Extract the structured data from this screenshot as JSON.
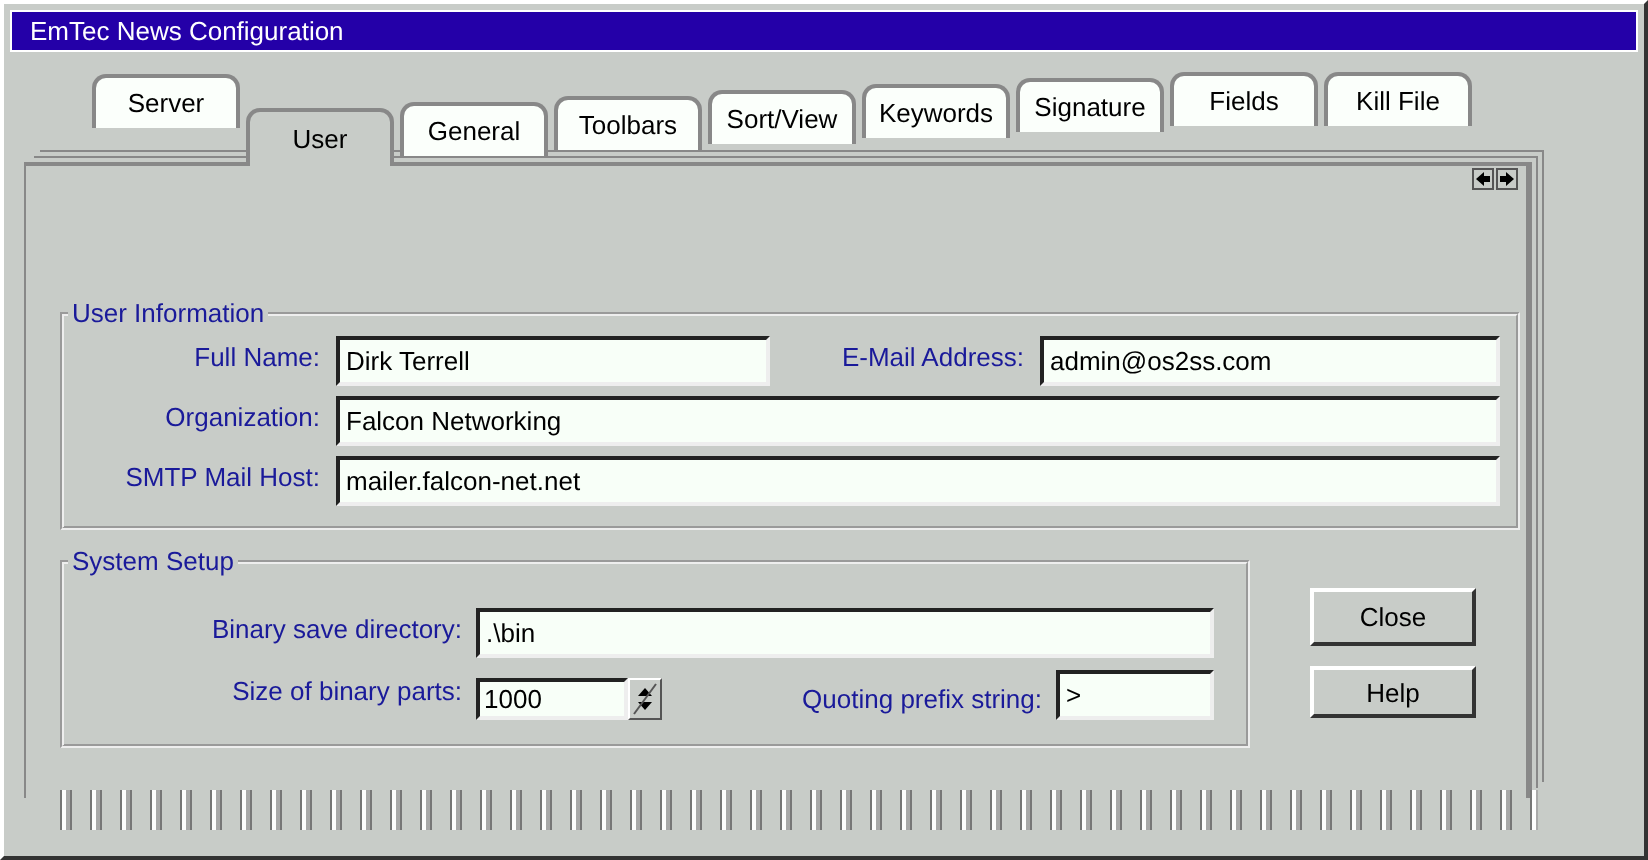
{
  "window": {
    "title": "EmTec News Configuration"
  },
  "tabs": [
    {
      "label": "Server",
      "selected": false
    },
    {
      "label": "User",
      "selected": true
    },
    {
      "label": "General",
      "selected": false
    },
    {
      "label": "Toolbars",
      "selected": false
    },
    {
      "label": "Sort/View",
      "selected": false
    },
    {
      "label": "Keywords",
      "selected": false
    },
    {
      "label": "Signature",
      "selected": false
    },
    {
      "label": "Fields",
      "selected": false
    },
    {
      "label": "Kill File",
      "selected": false
    }
  ],
  "user_information": {
    "title": "User Information",
    "fields": [
      {
        "label": "Full Name:",
        "value": "Dirk Terrell"
      },
      {
        "label": "E-Mail Address:",
        "value": "admin@os2ss.com"
      },
      {
        "label": "Organization:",
        "value": "Falcon Networking"
      },
      {
        "label": "SMTP Mail Host:",
        "value": "mailer.falcon-net.net"
      }
    ]
  },
  "system_setup": {
    "title": "System Setup",
    "fields": [
      {
        "label": "Binary save directory:",
        "value": ".\\bin",
        "kind": "text"
      },
      {
        "label": "Size of binary parts:",
        "value": "1000",
        "kind": "spin"
      },
      {
        "label": "Quoting prefix string:",
        "value": ">",
        "kind": "text"
      }
    ]
  },
  "buttons": [
    "Close",
    "Help"
  ]
}
